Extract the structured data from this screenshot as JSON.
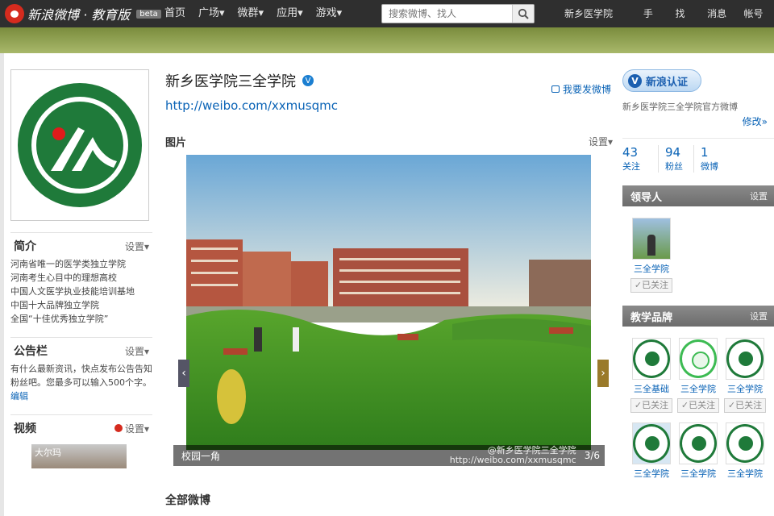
{
  "topbar": {
    "logo_text": "新浪微博 · 教育版",
    "beta": "beta",
    "nav": [
      "首页",
      "广场▾",
      "微群▾",
      "应用▾",
      "游戏▾"
    ],
    "search_placeholder": "搜索微博、找人",
    "right": [
      "新乡医学院三...",
      "手机",
      "找人",
      "消息▾",
      "帐号▾"
    ]
  },
  "profile": {
    "name": "新乡医学院三全学院",
    "url": "http://weibo.com/xxmusqmc",
    "post_link": "我要发微博"
  },
  "left": {
    "intro_title": "简介",
    "intro_setting": "设置▾",
    "intro_lines": [
      "河南省唯一的医学类独立学院",
      "河南考生心目中的理想高校",
      "中国人文医学执业技能培训基地",
      "中国十大品牌独立学院",
      "全国“十佳优秀独立学院”"
    ],
    "notice_title": "公告栏",
    "notice_setting": "设置▾",
    "notice_text": "有什么最新资讯，快点发布公告告知粉丝吧。您最多可以输入500个字。",
    "notice_edit": "编辑",
    "video_title": "视频",
    "video_setting": "设置▾",
    "video_thumb_text": "大尔玛"
  },
  "main": {
    "pics_title": "图片",
    "pics_setting": "设置▾",
    "caption": "校园一角",
    "counter": "3/6",
    "watermark": "@新乡医学院三全学院",
    "watermark_url": "http://weibo.com/xxmusqmc",
    "all_title": "全部微博"
  },
  "right": {
    "cert_label": "新浪认证",
    "cert_desc": "新乡医学院三全学院官方微博",
    "edit_label": "修改»",
    "stats": [
      {
        "n": "43",
        "l": "关注"
      },
      {
        "n": "94",
        "l": "粉丝"
      },
      {
        "n": "1",
        "l": "微博"
      }
    ],
    "leaders_title": "领导人",
    "leaders_setting": "设置",
    "leader": {
      "name": "三全学院",
      "follow": "已关注"
    },
    "brand_title": "教学品牌",
    "brand_setting": "设置",
    "brands": [
      {
        "name": "三全基础",
        "follow": "已关注"
      },
      {
        "name": "三全学院",
        "follow": "已关注"
      },
      {
        "name": "三全学院",
        "follow": "已关注"
      }
    ],
    "brands2": [
      {
        "name": "三全学院"
      },
      {
        "name": "三全学院"
      },
      {
        "name": "三全学院"
      }
    ]
  },
  "colors": {
    "topbar": "#2f2f2f",
    "link": "#0a63b6",
    "emblem_green": "#1f7a3a",
    "grass": "#3f9a2a"
  }
}
